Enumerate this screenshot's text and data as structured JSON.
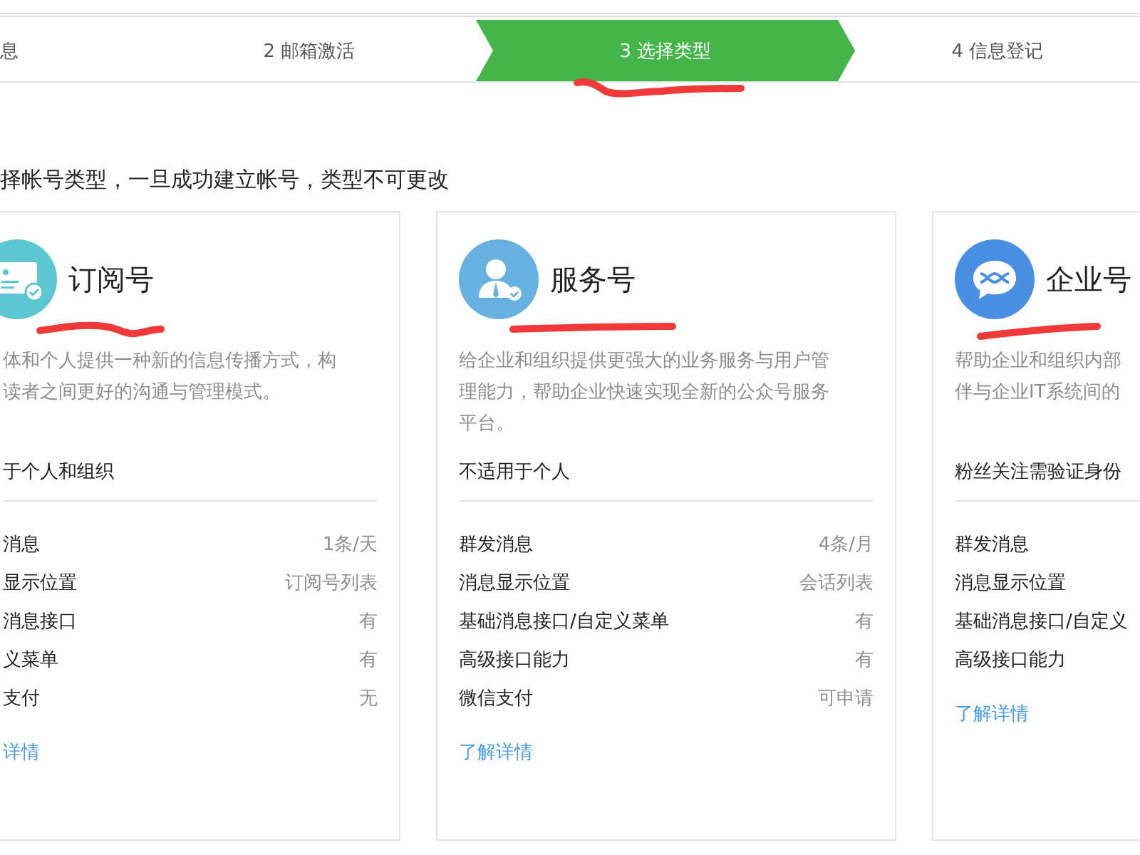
{
  "steps": [
    {
      "label": "息",
      "selected": false
    },
    {
      "label": "2 邮箱激活",
      "selected": false
    },
    {
      "label": "3 选择类型",
      "selected": true
    },
    {
      "label": "4 信息登记",
      "selected": false
    }
  ],
  "heading": "择帐号类型，一旦成功建立帐号，类型不可更改",
  "cards": [
    {
      "kind": "subscription",
      "title": "订阅号",
      "description": [
        "体和个人提供一种新的信息传播方式，构",
        "读者之间更好的沟通与管理模式。"
      ],
      "usage": "于个人和组织",
      "rows": [
        {
          "label": "消息",
          "value": "1条/天"
        },
        {
          "label": "显示位置",
          "value": "订阅号列表"
        },
        {
          "label": "消息接口",
          "value": "有"
        },
        {
          "label": "义菜单",
          "value": "有"
        },
        {
          "label": "支付",
          "value": "无"
        }
      ],
      "link": "详情"
    },
    {
      "kind": "service",
      "title": "服务号",
      "description": [
        "给企业和组织提供更强大的业务服务与用户管",
        "理能力，帮助企业快速实现全新的公众号服务",
        "平台。"
      ],
      "usage": "不适用于个人",
      "rows": [
        {
          "label": "群发消息",
          "value": "4条/月"
        },
        {
          "label": "消息显示位置",
          "value": "会话列表"
        },
        {
          "label": "基础消息接口/自定义菜单",
          "value": "有"
        },
        {
          "label": "高级接口能力",
          "value": "有"
        },
        {
          "label": "微信支付",
          "value": "可申请"
        }
      ],
      "link": "了解详情"
    },
    {
      "kind": "enterprise",
      "title": "企业号",
      "description": [
        "帮助企业和组织内部",
        "伴与企业IT系统间的"
      ],
      "usage": "粉丝关注需验证身份",
      "rows": [
        {
          "label": "群发消息"
        },
        {
          "label": "消息显示位置"
        },
        {
          "label": "基础消息接口/自定义"
        },
        {
          "label": "高级接口能力"
        }
      ],
      "link": "了解详情"
    }
  ]
}
